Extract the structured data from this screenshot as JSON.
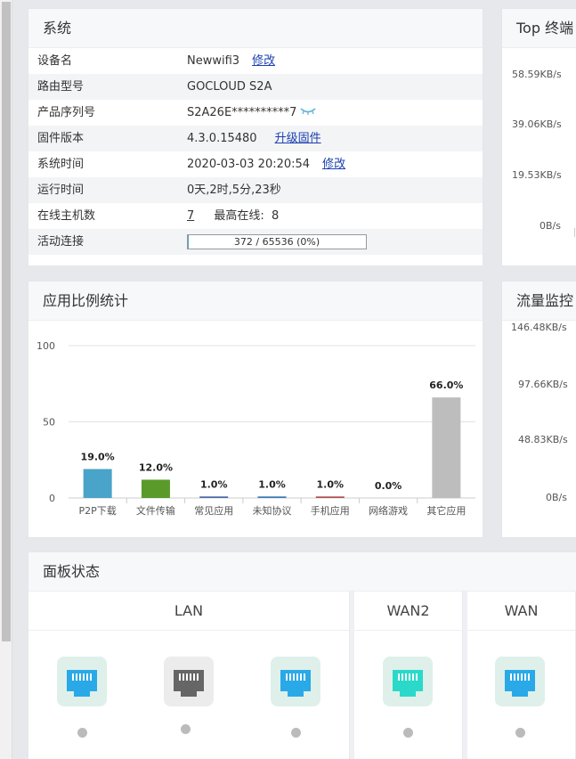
{
  "system": {
    "title": "系统",
    "rows": [
      {
        "label": "设备名",
        "value": "Newwifi3",
        "action": "修改"
      },
      {
        "label": "路由型号",
        "value": "GOCLOUD S2A"
      },
      {
        "label": "产品序列号",
        "value": "S2A26E**********7",
        "icon": "eye-closed-icon"
      },
      {
        "label": "固件版本",
        "value": "4.3.0.15480",
        "action": "升级固件"
      },
      {
        "label": "系统时间",
        "value": "2020-03-03 20:20:54",
        "action": "修改"
      },
      {
        "label": "运行时间",
        "value": "0天,2时,5分,23秒"
      },
      {
        "label": "在线主机数",
        "value": "7",
        "extra_label": "最高在线:",
        "extra_value": "8"
      },
      {
        "label": "活动连接",
        "value": "372 / 65536 (0%)",
        "progress": 0.0057
      }
    ]
  },
  "top_terminals": {
    "title": "Top 终端",
    "y_ticks": [
      "58.59KB/s",
      "39.06KB/s",
      "19.53KB/s",
      "0B/s"
    ]
  },
  "app_ratio": {
    "title": "应用比例统计"
  },
  "chart_data": {
    "type": "bar",
    "categories": [
      "P2P下载",
      "文件传输",
      "常见应用",
      "未知协议",
      "手机应用",
      "网络游戏",
      "其它应用"
    ],
    "values": [
      19.0,
      12.0,
      1.0,
      1.0,
      1.0,
      0.0,
      66.0
    ],
    "data_labels": [
      "19.0%",
      "12.0%",
      "1.0%",
      "1.0%",
      "1.0%",
      "0.0%",
      "66.0%"
    ],
    "colors": [
      "#4aa3c8",
      "#5a9a2a",
      "#4a6aa8",
      "#3a7ab8",
      "#b05050",
      "#888888",
      "#bdbdbd"
    ],
    "y_ticks": [
      0,
      50,
      100
    ],
    "ylim": [
      0,
      100
    ],
    "grid": true
  },
  "flow_monitor": {
    "title": "流量监控",
    "y_ticks": [
      "146.48KB/s",
      "97.66KB/s",
      "48.83KB/s",
      "0B/s"
    ]
  },
  "panel_status": {
    "title": "面板状态",
    "groups": [
      {
        "label": "LAN",
        "ports": [
          {
            "color": "#2aa9e8",
            "bg": "#dff0ea"
          },
          {
            "color": "#666666",
            "bg": "#ececec"
          },
          {
            "color": "#2aa9e8",
            "bg": "#dff0ea"
          }
        ]
      },
      {
        "label": "WAN2",
        "ports": [
          {
            "color": "#2ad9c9",
            "bg": "#dff0ea"
          }
        ]
      },
      {
        "label": "WAN",
        "ports": [
          {
            "color": "#2aa9e8",
            "bg": "#dff0ea"
          }
        ]
      }
    ]
  }
}
